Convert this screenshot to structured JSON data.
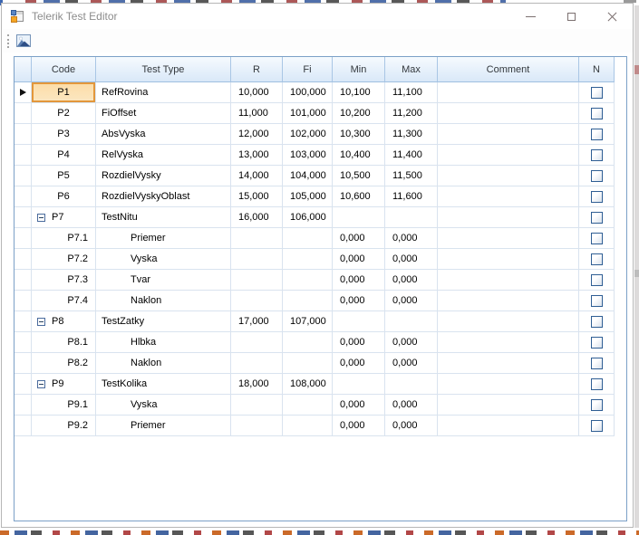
{
  "window": {
    "title": "Telerik Test Editor"
  },
  "toolbar": {
    "buttons": [
      {
        "id": "image-tool",
        "icon": "picture-icon"
      }
    ]
  },
  "grid": {
    "columns": [
      {
        "key": "rowheader",
        "label": ""
      },
      {
        "key": "code",
        "label": "Code"
      },
      {
        "key": "testType",
        "label": "Test Type"
      },
      {
        "key": "r",
        "label": "R"
      },
      {
        "key": "fi",
        "label": "Fi"
      },
      {
        "key": "min",
        "label": "Min"
      },
      {
        "key": "max",
        "label": "Max"
      },
      {
        "key": "comment",
        "label": "Comment"
      },
      {
        "key": "n",
        "label": "N"
      }
    ],
    "rows": [
      {
        "code": "P1",
        "testType": "RefRovina",
        "r": "10,000",
        "fi": "100,000",
        "min": "10,100",
        "max": "11,100",
        "comment": "",
        "n": false,
        "kind": "item",
        "current": true,
        "selected_cell": "code"
      },
      {
        "code": "P2",
        "testType": "FiOffset",
        "r": "11,000",
        "fi": "101,000",
        "min": "10,200",
        "max": "11,200",
        "comment": "",
        "n": false,
        "kind": "item"
      },
      {
        "code": "P3",
        "testType": "AbsVyska",
        "r": "12,000",
        "fi": "102,000",
        "min": "10,300",
        "max": "11,300",
        "comment": "",
        "n": false,
        "kind": "item"
      },
      {
        "code": "P4",
        "testType": "RelVyska",
        "r": "13,000",
        "fi": "103,000",
        "min": "10,400",
        "max": "11,400",
        "comment": "",
        "n": false,
        "kind": "item"
      },
      {
        "code": "P5",
        "testType": "RozdielVysky",
        "r": "14,000",
        "fi": "104,000",
        "min": "10,500",
        "max": "11,500",
        "comment": "",
        "n": false,
        "kind": "item"
      },
      {
        "code": "P6",
        "testType": "RozdielVyskyOblast",
        "r": "15,000",
        "fi": "105,000",
        "min": "10,600",
        "max": "11,600",
        "comment": "",
        "n": false,
        "kind": "item"
      },
      {
        "code": "P7",
        "testType": "TestNitu",
        "r": "16,000",
        "fi": "106,000",
        "min": "",
        "max": "",
        "comment": "",
        "n": false,
        "kind": "group",
        "expanded": true
      },
      {
        "code": "P7.1",
        "testType": "Priemer",
        "r": "",
        "fi": "",
        "min": "0,000",
        "max": "0,000",
        "comment": "",
        "n": false,
        "kind": "child"
      },
      {
        "code": "P7.2",
        "testType": "Vyska",
        "r": "",
        "fi": "",
        "min": "0,000",
        "max": "0,000",
        "comment": "",
        "n": false,
        "kind": "child"
      },
      {
        "code": "P7.3",
        "testType": "Tvar",
        "r": "",
        "fi": "",
        "min": "0,000",
        "max": "0,000",
        "comment": "",
        "n": false,
        "kind": "child"
      },
      {
        "code": "P7.4",
        "testType": "Naklon",
        "r": "",
        "fi": "",
        "min": "0,000",
        "max": "0,000",
        "comment": "",
        "n": false,
        "kind": "child"
      },
      {
        "code": "P8",
        "testType": "TestZatky",
        "r": "17,000",
        "fi": "107,000",
        "min": "",
        "max": "",
        "comment": "",
        "n": false,
        "kind": "group",
        "expanded": true
      },
      {
        "code": "P8.1",
        "testType": "Hlbka",
        "r": "",
        "fi": "",
        "min": "0,000",
        "max": "0,000",
        "comment": "",
        "n": false,
        "kind": "child"
      },
      {
        "code": "P8.2",
        "testType": "Naklon",
        "r": "",
        "fi": "",
        "min": "0,000",
        "max": "0,000",
        "comment": "",
        "n": false,
        "kind": "child"
      },
      {
        "code": "P9",
        "testType": "TestKolika",
        "r": "18,000",
        "fi": "108,000",
        "min": "",
        "max": "",
        "comment": "",
        "n": false,
        "kind": "group",
        "expanded": true
      },
      {
        "code": "P9.1",
        "testType": "Vyska",
        "r": "",
        "fi": "",
        "min": "0,000",
        "max": "0,000",
        "comment": "",
        "n": false,
        "kind": "child"
      },
      {
        "code": "P9.2",
        "testType": "Priemer",
        "r": "",
        "fi": "",
        "min": "0,000",
        "max": "0,000",
        "comment": "",
        "n": false,
        "kind": "child"
      }
    ]
  },
  "colors": {
    "grid_border": "#7BA0C7",
    "header_gradient_top": "#F6FAFE",
    "header_gradient_bottom": "#D9E8F8",
    "cell_border": "#D9E3EF",
    "selected_cell_bg": "#FBDCA6",
    "selected_cell_border": "#E3973B",
    "checkbox_border": "#2F5E94",
    "title_text": "#8C8C8C",
    "window_control": "#7C7070"
  }
}
